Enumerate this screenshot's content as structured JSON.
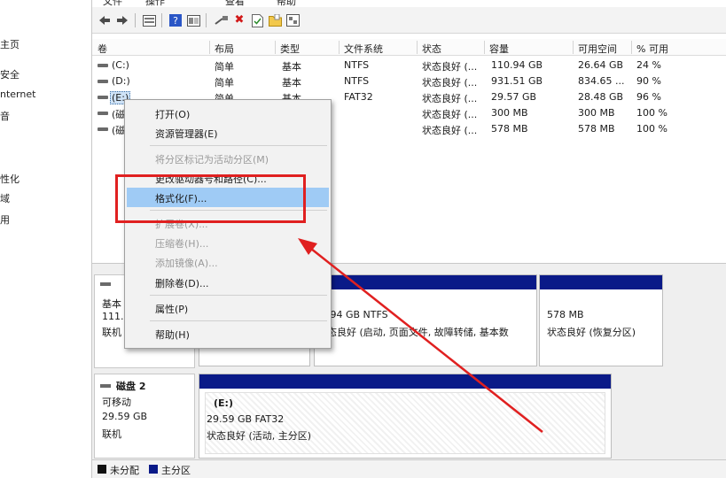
{
  "nav": {
    "items": [
      "主页",
      "安全",
      "nternet",
      "音",
      "性化",
      "域",
      "用"
    ]
  },
  "menubar": {
    "items": [
      "文件",
      "操作",
      "查看",
      "帮助"
    ]
  },
  "toolbar": {
    "icons": [
      "back-arrow-icon",
      "forward-arrow-icon",
      "disk-list-icon",
      "help-icon",
      "properties-icon",
      "connect-icon",
      "delete-icon",
      "check-icon",
      "folder-icon",
      "settings-icon"
    ]
  },
  "volume_list": {
    "columns": [
      "卷",
      "布局",
      "类型",
      "文件系统",
      "状态",
      "容量",
      "可用空间",
      "% 可用"
    ],
    "rows": [
      {
        "volume": "(C:)",
        "layout": "简单",
        "type": "基本",
        "fs": "NTFS",
        "status": "状态良好 (...",
        "capacity": "110.94 GB",
        "free": "26.64 GB",
        "pct": "24 %"
      },
      {
        "volume": "(D:)",
        "layout": "简单",
        "type": "基本",
        "fs": "NTFS",
        "status": "状态良好 (...",
        "capacity": "931.51 GB",
        "free": "834.65 ...",
        "pct": "90 %"
      },
      {
        "volume": "(E:)",
        "layout": "简单",
        "type": "基本",
        "fs": "FAT32",
        "status": "状态良好 (...",
        "capacity": "29.57 GB",
        "free": "28.48 GB",
        "pct": "96 %"
      },
      {
        "volume": "(磁",
        "layout": "",
        "type": "",
        "fs": "",
        "status": "状态良好 (...",
        "capacity": "300 MB",
        "free": "300 MB",
        "pct": "100 %"
      },
      {
        "volume": "(磁",
        "layout": "",
        "type": "",
        "fs": "",
        "status": "状态良好 (...",
        "capacity": "578 MB",
        "free": "578 MB",
        "pct": "100 %"
      }
    ]
  },
  "context_menu": {
    "items": [
      {
        "label": "打开(O)",
        "disabled": false
      },
      {
        "label": "资源管理器(E)",
        "disabled": false
      },
      {
        "label": "将分区标记为活动分区(M)",
        "disabled": true
      },
      {
        "label": "更改驱动器号和路径(C)...",
        "disabled": false
      },
      {
        "label": "格式化(F)...",
        "disabled": false,
        "highlighted": true
      },
      {
        "label": "扩展卷(X)...",
        "disabled": true
      },
      {
        "label": "压缩卷(H)...",
        "disabled": true
      },
      {
        "label": "添加镜像(A)...",
        "disabled": true
      },
      {
        "label": "删除卷(D)...",
        "disabled": false
      },
      {
        "label": "属性(P)",
        "disabled": false
      },
      {
        "label": "帮助(H)",
        "disabled": false
      }
    ]
  },
  "disk1": {
    "label_lines": [
      "基本",
      "111.",
      "联机"
    ],
    "partitions": [
      {
        "lines": [
          ".94 GB NTFS",
          "态良好 (启动, 页面文件, 故障转储, 基本数"
        ]
      },
      {
        "lines": [
          "578 MB",
          "状态良好 (恢复分区)"
        ]
      }
    ]
  },
  "disk2": {
    "name": "磁盘 2",
    "label_lines": [
      "可移动",
      "29.59 GB",
      "联机"
    ],
    "partition": {
      "lines": [
        "(E:)",
        "29.59 GB FAT32",
        "状态良好 (活动, 主分区)"
      ]
    }
  },
  "legend": {
    "items": [
      {
        "label": "未分配",
        "color": "#111111"
      },
      {
        "label": "主分区",
        "color": "#0a1a88"
      }
    ]
  },
  "colors": {
    "primary_partition": "#0a1a88",
    "highlight": "#9fcbf5",
    "annotation": "#e02020"
  }
}
